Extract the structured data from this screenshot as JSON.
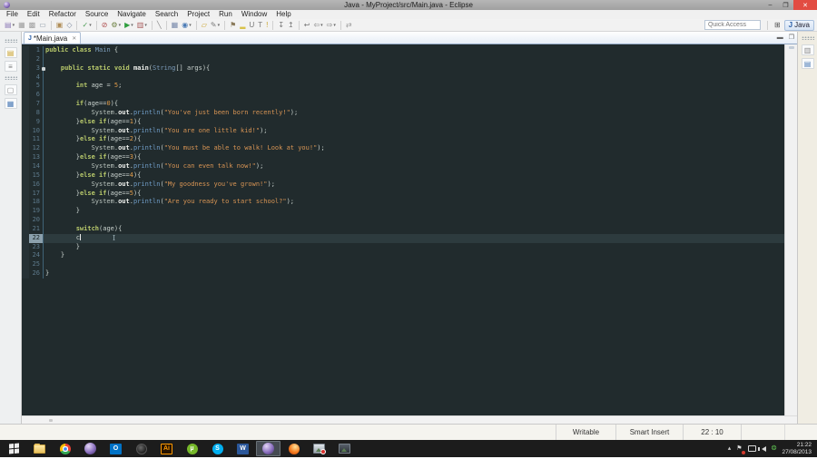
{
  "window": {
    "title": "Java - MyProject/src/Main.java - Eclipse"
  },
  "titlebar_controls": {
    "minimize": "–",
    "maximize": "❐",
    "close": "✕"
  },
  "menus": [
    "File",
    "Edit",
    "Refactor",
    "Source",
    "Navigate",
    "Search",
    "Project",
    "Run",
    "Window",
    "Help"
  ],
  "toolbar": {
    "quick_access_placeholder": "Quick Access",
    "perspective_label": "Java",
    "perspective_icon": "J",
    "open_perspective_glyph": "⊞",
    "icons": [
      {
        "name": "new-wizard",
        "glyph": "▤",
        "color": "#8f7cb8",
        "dd": true
      },
      {
        "name": "save",
        "glyph": "▦",
        "color": "#a0a0a0"
      },
      {
        "name": "save-all",
        "glyph": "▩",
        "color": "#a0a0a0"
      },
      {
        "name": "print",
        "glyph": "▭",
        "color": "#8a98a6"
      },
      {
        "name": "new-java-project",
        "glyph": "▣",
        "color": "#b08d57",
        "sep": true
      },
      {
        "name": "open-type",
        "glyph": "◇",
        "color": "#7f8aa0"
      },
      {
        "name": "new-java-class",
        "glyph": "✓",
        "color": "#4f9e58",
        "dd": true,
        "sep": true
      },
      {
        "name": "skip-all-breakpoints",
        "glyph": "⊘",
        "color": "#b05050",
        "sep": true
      },
      {
        "name": "debug",
        "glyph": "⚙",
        "color": "#6b7f3f",
        "dd": true
      },
      {
        "name": "run",
        "glyph": "▶",
        "color": "#2f9e3f",
        "dd": true
      },
      {
        "name": "coverage",
        "glyph": "▥",
        "color": "#a85a5a",
        "dd": true
      },
      {
        "name": "connection",
        "glyph": "╲",
        "color": "#888888",
        "sep": true
      },
      {
        "name": "java-ee-grid",
        "glyph": "▦",
        "color": "#7788aa",
        "sep": true
      },
      {
        "name": "open-web-browser",
        "glyph": "◉",
        "color": "#4a7ab5",
        "dd": true
      },
      {
        "name": "open-folder",
        "glyph": "▱",
        "color": "#c9a227",
        "sep": true
      },
      {
        "name": "external-tools",
        "glyph": "✎",
        "color": "#7a7a7a",
        "dd": true
      },
      {
        "name": "next-task",
        "glyph": "⚑",
        "color": "#8a7a5a",
        "sep": true
      },
      {
        "name": "mark-occurrences",
        "glyph": "▂",
        "color": "#d8c24a"
      },
      {
        "name": "annotation-u",
        "glyph": "U",
        "color": "#777777"
      },
      {
        "name": "annotation-t",
        "glyph": "T",
        "color": "#777777"
      },
      {
        "name": "quick-fix",
        "glyph": "!",
        "color": "#c9a227"
      },
      {
        "name": "next-annotation",
        "glyph": "↧",
        "color": "#777777",
        "sep": true
      },
      {
        "name": "previous-annotation",
        "glyph": "↥",
        "color": "#777777"
      },
      {
        "name": "last-edit-location",
        "glyph": "↩",
        "color": "#777777",
        "sep": true
      },
      {
        "name": "back",
        "glyph": "⇦",
        "color": "#777777",
        "dd": true
      },
      {
        "name": "forward",
        "glyph": "⇨",
        "color": "#777777",
        "dd": true
      },
      {
        "name": "link-with-editor",
        "glyph": "⇄",
        "color": "#999999",
        "sep": true
      }
    ]
  },
  "editor": {
    "tab_label": "*Main.java",
    "tab_icon": "J",
    "tab_close_glyph": "✕",
    "minimize_glyph": "▬",
    "maximize_glyph": "❐"
  },
  "code": {
    "language": "java",
    "lines": [
      {
        "n": 1,
        "segs": [
          [
            "k",
            "public class "
          ],
          [
            "t",
            "Main"
          ],
          [
            "p",
            " {"
          ]
        ]
      },
      {
        "n": 2,
        "segs": []
      },
      {
        "n": 3,
        "marker": true,
        "segs": [
          [
            "p",
            "    "
          ],
          [
            "k",
            "public static void "
          ],
          [
            "m",
            "main"
          ],
          [
            "p",
            "("
          ],
          [
            "t",
            "String"
          ],
          [
            "p",
            "[] args){"
          ]
        ]
      },
      {
        "n": 4,
        "segs": []
      },
      {
        "n": 5,
        "segs": [
          [
            "p",
            "        "
          ],
          [
            "k",
            "int"
          ],
          [
            "p",
            " age = "
          ],
          [
            "n",
            "5"
          ],
          [
            "p",
            ";"
          ]
        ]
      },
      {
        "n": 6,
        "segs": []
      },
      {
        "n": 7,
        "segs": [
          [
            "p",
            "        "
          ],
          [
            "k",
            "if"
          ],
          [
            "p",
            "(age=="
          ],
          [
            "n",
            "0"
          ],
          [
            "p",
            "){"
          ]
        ]
      },
      {
        "n": 8,
        "segs": [
          [
            "p",
            "            "
          ],
          [
            "sys",
            "System"
          ],
          [
            "p",
            "."
          ],
          [
            "o",
            "out"
          ],
          [
            "p",
            "."
          ],
          [
            "f",
            "println"
          ],
          [
            "p",
            "("
          ],
          [
            "s",
            "\"You've just been born recently!\""
          ],
          [
            "p",
            ");"
          ]
        ]
      },
      {
        "n": 9,
        "segs": [
          [
            "p",
            "        }"
          ],
          [
            "k",
            "else if"
          ],
          [
            "p",
            "(age=="
          ],
          [
            "n",
            "1"
          ],
          [
            "p",
            "){"
          ]
        ]
      },
      {
        "n": 10,
        "segs": [
          [
            "p",
            "            "
          ],
          [
            "sys",
            "System"
          ],
          [
            "p",
            "."
          ],
          [
            "o",
            "out"
          ],
          [
            "p",
            "."
          ],
          [
            "f",
            "println"
          ],
          [
            "p",
            "("
          ],
          [
            "s",
            "\"You are one little kid!\""
          ],
          [
            "p",
            ");"
          ]
        ]
      },
      {
        "n": 11,
        "segs": [
          [
            "p",
            "        }"
          ],
          [
            "k",
            "else if"
          ],
          [
            "p",
            "(age=="
          ],
          [
            "n",
            "2"
          ],
          [
            "p",
            "){"
          ]
        ]
      },
      {
        "n": 12,
        "segs": [
          [
            "p",
            "            "
          ],
          [
            "sys",
            "System"
          ],
          [
            "p",
            "."
          ],
          [
            "o",
            "out"
          ],
          [
            "p",
            "."
          ],
          [
            "f",
            "println"
          ],
          [
            "p",
            "("
          ],
          [
            "s",
            "\"You must be able to walk! Look at you!\""
          ],
          [
            "p",
            ");"
          ]
        ]
      },
      {
        "n": 13,
        "segs": [
          [
            "p",
            "        }"
          ],
          [
            "k",
            "else if"
          ],
          [
            "p",
            "(age=="
          ],
          [
            "n",
            "3"
          ],
          [
            "p",
            "){"
          ]
        ]
      },
      {
        "n": 14,
        "segs": [
          [
            "p",
            "            "
          ],
          [
            "sys",
            "System"
          ],
          [
            "p",
            "."
          ],
          [
            "o",
            "out"
          ],
          [
            "p",
            "."
          ],
          [
            "f",
            "println"
          ],
          [
            "p",
            "("
          ],
          [
            "s",
            "\"You can even talk now!\""
          ],
          [
            "p",
            ");"
          ]
        ]
      },
      {
        "n": 15,
        "segs": [
          [
            "p",
            "        }"
          ],
          [
            "k",
            "else if"
          ],
          [
            "p",
            "(age=="
          ],
          [
            "n",
            "4"
          ],
          [
            "p",
            "){"
          ]
        ]
      },
      {
        "n": 16,
        "segs": [
          [
            "p",
            "            "
          ],
          [
            "sys",
            "System"
          ],
          [
            "p",
            "."
          ],
          [
            "o",
            "out"
          ],
          [
            "p",
            "."
          ],
          [
            "f",
            "println"
          ],
          [
            "p",
            "("
          ],
          [
            "s",
            "\"My goodness you've grown!\""
          ],
          [
            "p",
            ");"
          ]
        ]
      },
      {
        "n": 17,
        "segs": [
          [
            "p",
            "        }"
          ],
          [
            "k",
            "else if"
          ],
          [
            "p",
            "(age=="
          ],
          [
            "n",
            "5"
          ],
          [
            "p",
            "){"
          ]
        ]
      },
      {
        "n": 18,
        "segs": [
          [
            "p",
            "            "
          ],
          [
            "sys",
            "System"
          ],
          [
            "p",
            "."
          ],
          [
            "o",
            "out"
          ],
          [
            "p",
            "."
          ],
          [
            "f",
            "println"
          ],
          [
            "p",
            "("
          ],
          [
            "s",
            "\"Are you ready to start school?\""
          ],
          [
            "p",
            ");"
          ]
        ]
      },
      {
        "n": 19,
        "segs": [
          [
            "p",
            "        }"
          ]
        ]
      },
      {
        "n": 20,
        "segs": []
      },
      {
        "n": 21,
        "segs": [
          [
            "p",
            "        "
          ],
          [
            "k",
            "switch"
          ],
          [
            "p",
            "(age){"
          ]
        ]
      },
      {
        "n": 22,
        "current": true,
        "caret": true,
        "ibeam": true,
        "segs": [
          [
            "p",
            "        c"
          ]
        ]
      },
      {
        "n": 23,
        "segs": [
          [
            "p",
            "        }"
          ]
        ]
      },
      {
        "n": 24,
        "segs": [
          [
            "p",
            "    }"
          ]
        ]
      },
      {
        "n": 25,
        "segs": []
      },
      {
        "n": 26,
        "segs": [
          [
            "p",
            "}"
          ]
        ]
      }
    ]
  },
  "status": {
    "fields": [
      "Writable",
      "Smart Insert",
      "22 : 10"
    ]
  },
  "taskbar": {
    "items": [
      {
        "name": "taskbar-start-button",
        "kind": "start"
      },
      {
        "name": "taskbar-file-explorer-button",
        "kind": "folder"
      },
      {
        "name": "taskbar-chrome-button",
        "kind": "chrome"
      },
      {
        "name": "taskbar-purple-orb-app-button",
        "kind": "orb"
      },
      {
        "name": "taskbar-outlook-button",
        "kind": "tile",
        "bg": "#0072c6",
        "fg": "#ffffff",
        "label": "O"
      },
      {
        "name": "taskbar-media-app-button",
        "kind": "darkball"
      },
      {
        "name": "taskbar-illustrator-button",
        "kind": "tile",
        "bg": "#261300",
        "fg": "#ff9a00",
        "label": "Ai",
        "border": "#ff9a00"
      },
      {
        "name": "taskbar-utorrent-button",
        "kind": "circ",
        "bg": "#76b82a",
        "fg": "#ffffff",
        "label": "µ"
      },
      {
        "name": "taskbar-skype-button",
        "kind": "circ",
        "bg": "#00aff0",
        "fg": "#ffffff",
        "label": "S"
      },
      {
        "name": "taskbar-word-button",
        "kind": "tile",
        "bg": "#2b579a",
        "fg": "#ffffff",
        "label": "W"
      },
      {
        "name": "taskbar-eclipse-button",
        "kind": "orb",
        "active": true
      },
      {
        "name": "taskbar-firefox-button",
        "kind": "ff"
      },
      {
        "name": "taskbar-photos-app-button",
        "kind": "photo-red"
      },
      {
        "name": "taskbar-image-viewer-button",
        "kind": "photo-dark"
      }
    ],
    "tray": [
      {
        "name": "show-hidden-icons",
        "kind": "glyph",
        "glyph": "▴",
        "color": "#cccccc"
      },
      {
        "name": "action-center-flag-icon",
        "kind": "glyph",
        "glyph": "⚑",
        "color": "#dddddd",
        "badge": true
      },
      {
        "name": "network-icon",
        "kind": "monitor"
      },
      {
        "name": "volume-icon",
        "kind": "speaker"
      },
      {
        "name": "antivirus-icon",
        "kind": "glyph",
        "glyph": "❂",
        "color": "#59b24d"
      }
    ],
    "clock": {
      "time": "21:22",
      "date": "27/08/2013"
    }
  },
  "colors": {
    "editor_background": "#212b2d",
    "current_line": "#2d3b3e",
    "keyword": "#b8c96b",
    "string": "#d79454",
    "number": "#e09c4a",
    "type": "#7d9ebc",
    "method_call": "#6f9cc6",
    "line_number": "#5d7a8c",
    "close_button": "#e24c42",
    "taskbar_background": "#1c1c1c"
  }
}
